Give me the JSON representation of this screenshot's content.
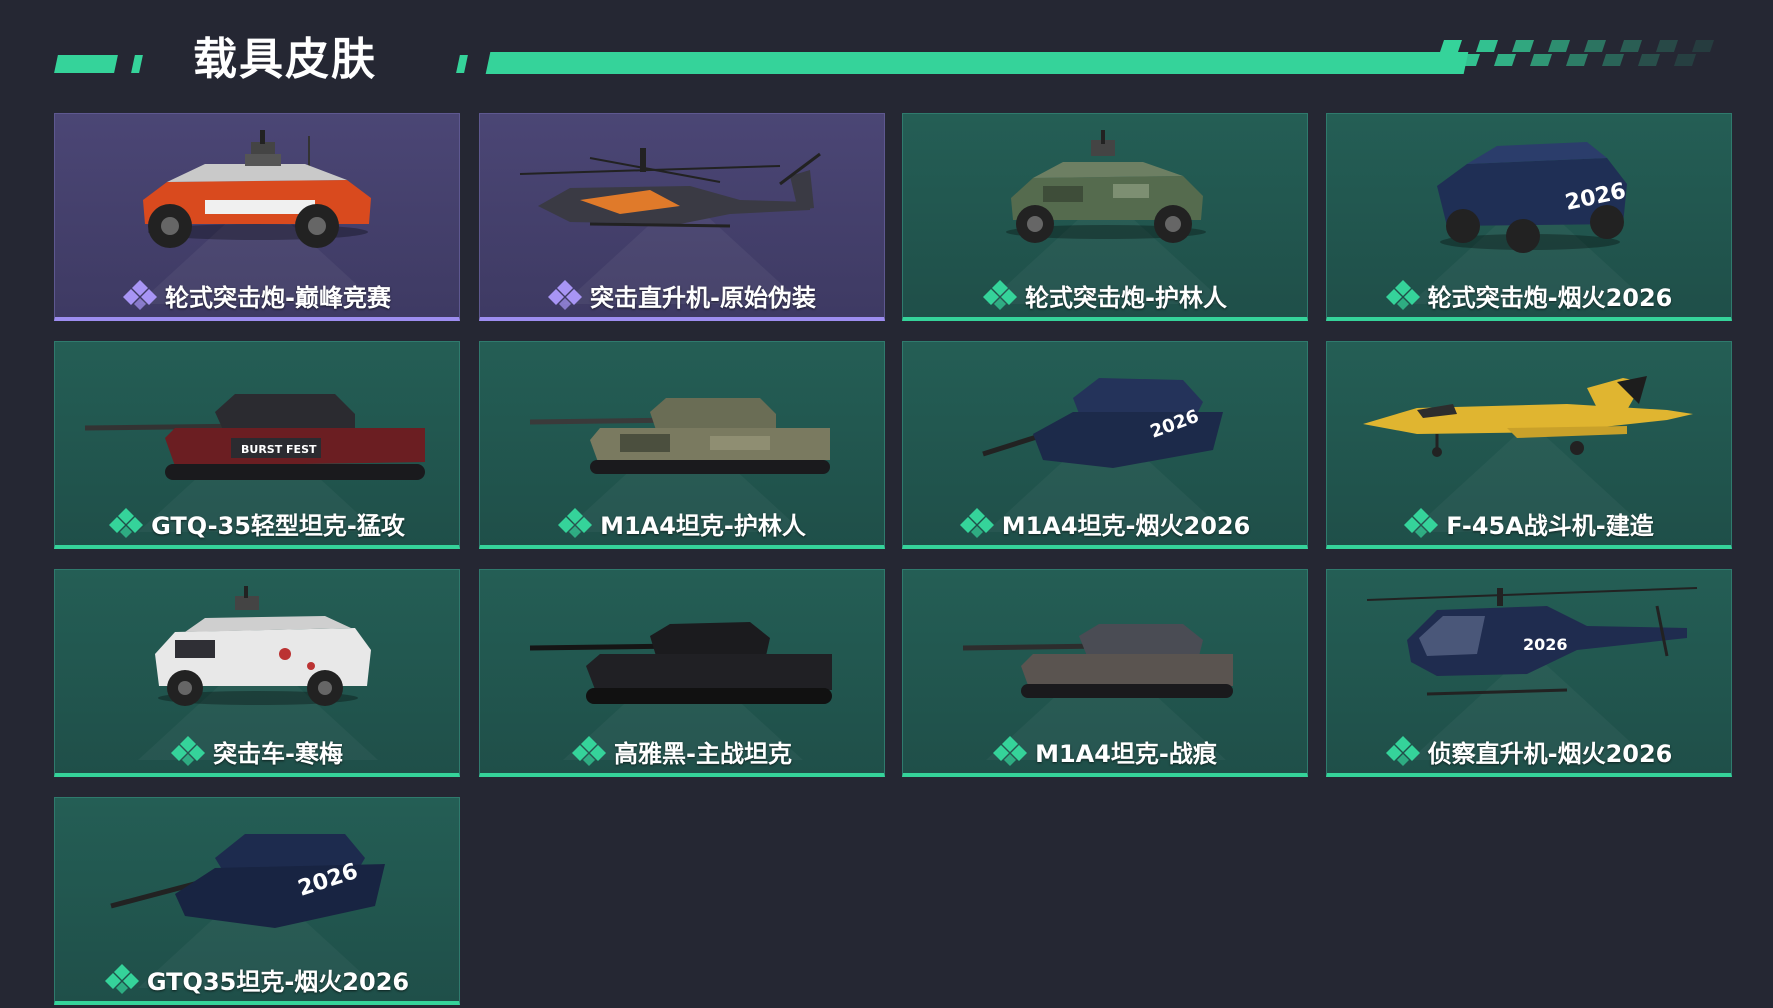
{
  "page": {
    "title": "载具皮肤",
    "accent_color": "#35d39a",
    "background_color": "#252733"
  },
  "cards": [
    {
      "name": "轮式突击炮-巅峰竞赛",
      "rarity": "purple",
      "icon": "wheeled-assault-gun-red"
    },
    {
      "name": "突击直升机-原始伪装",
      "rarity": "purple",
      "icon": "attack-helicopter"
    },
    {
      "name": "轮式突击炮-护林人",
      "rarity": "green",
      "icon": "wheeled-assault-gun-camo"
    },
    {
      "name": "轮式突击炮-烟火2026",
      "rarity": "green",
      "icon": "wheeled-assault-gun-navy"
    },
    {
      "name": "GTQ-35轻型坦克-猛攻",
      "rarity": "green",
      "icon": "light-tank-red"
    },
    {
      "name": "M1A4坦克-护林人",
      "rarity": "green",
      "icon": "tank-camo"
    },
    {
      "name": "M1A4坦克-烟火2026",
      "rarity": "green",
      "icon": "tank-navy"
    },
    {
      "name": "F-45A战斗机-建造",
      "rarity": "green",
      "icon": "fighter-jet-yellow"
    },
    {
      "name": "突击车-寒梅",
      "rarity": "green",
      "icon": "assault-vehicle-white"
    },
    {
      "name": "高雅黑-主战坦克",
      "rarity": "green",
      "icon": "tank-black"
    },
    {
      "name": "M1A4坦克-战痕",
      "rarity": "green",
      "icon": "tank-grey"
    },
    {
      "name": "侦察直升机-烟火2026",
      "rarity": "green",
      "icon": "scout-helicopter-navy"
    },
    {
      "name": "GTQ35坦克-烟火2026",
      "rarity": "green",
      "icon": "tank-navy-2026"
    }
  ],
  "badge": {
    "text": "2026",
    "burst_text": "BURST FEST"
  }
}
